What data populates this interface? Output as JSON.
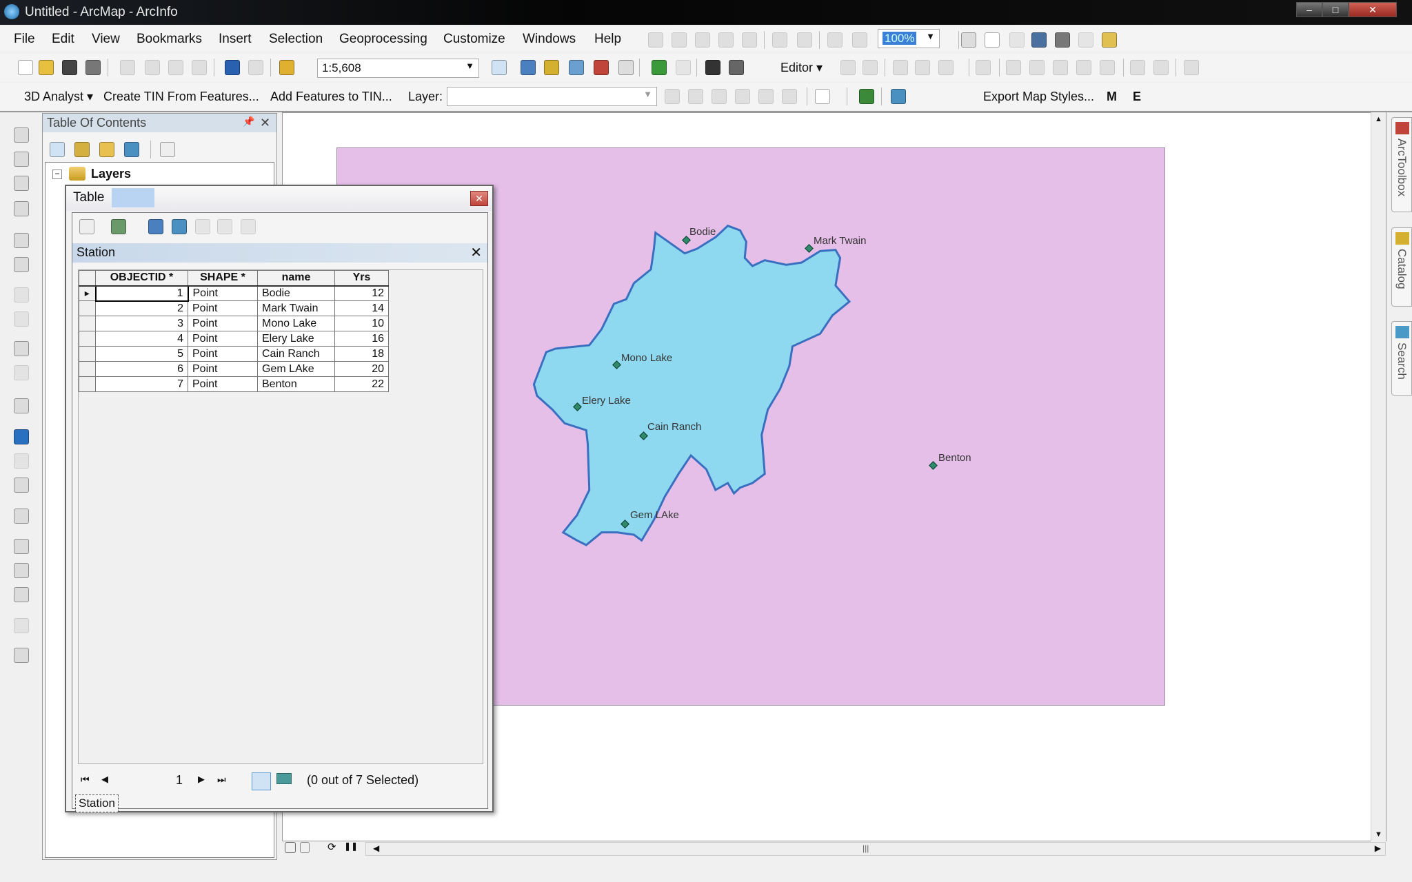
{
  "window": {
    "title": "Untitled - ArcMap - ArcInfo",
    "minimize": "‒",
    "maximize": "□",
    "close": "✕"
  },
  "menu": [
    "File",
    "Edit",
    "View",
    "Bookmarks",
    "Insert",
    "Selection",
    "Geoprocessing",
    "Customize",
    "Windows",
    "Help"
  ],
  "standard_toolbar": {
    "scale": "1:5,608"
  },
  "layout_toolbar": {
    "zoom_percent": "100%"
  },
  "editor_toolbar": {
    "editor_label": "Editor ▾"
  },
  "analyst_toolbar": {
    "analyst_label": "3D Analyst ▾",
    "create_tin": "Create TIN From Features...",
    "add_features": "Add Features to TIN...",
    "layer_label": "Layer:",
    "layer_value": ""
  },
  "export_toolbar": {
    "export_label": "Export Map Styles...",
    "m": "M",
    "e": "E"
  },
  "toc": {
    "title": "Table Of Contents",
    "pin": "📌",
    "close": "✕",
    "root_layer": "Layers",
    "collapse": "−"
  },
  "side_tabs": [
    "ArcToolbox",
    "Catalog",
    "Search"
  ],
  "table_window": {
    "title": "Table",
    "close": "✕",
    "table_name": "Station",
    "columns": [
      "OBJECTID *",
      "SHAPE *",
      "name",
      "Yrs"
    ],
    "rows": [
      [
        "1",
        "Point",
        "Bodie",
        "12"
      ],
      [
        "2",
        "Point",
        "Mark Twain",
        "14"
      ],
      [
        "3",
        "Point",
        "Mono Lake",
        "10"
      ],
      [
        "4",
        "Point",
        "Elery Lake",
        "16"
      ],
      [
        "5",
        "Point",
        "Cain Ranch",
        "18"
      ],
      [
        "6",
        "Point",
        "Gem LAke",
        "20"
      ],
      [
        "7",
        "Point",
        "Benton",
        "22"
      ]
    ],
    "current_record": "1",
    "selection_status": "(0 out of 7 Selected)",
    "tab_label": "Station"
  },
  "map": {
    "stations": [
      "Bodie",
      "Mark Twain",
      "Mono Lake",
      "Elery Lake",
      "Cain Ranch",
      "Gem LAke",
      "Benton"
    ],
    "colors": {
      "page": "#e6bfe9",
      "polygon": "#8fd9f0",
      "polygon_outline": "#3a6fc0",
      "point": "#2e8a6a"
    }
  }
}
